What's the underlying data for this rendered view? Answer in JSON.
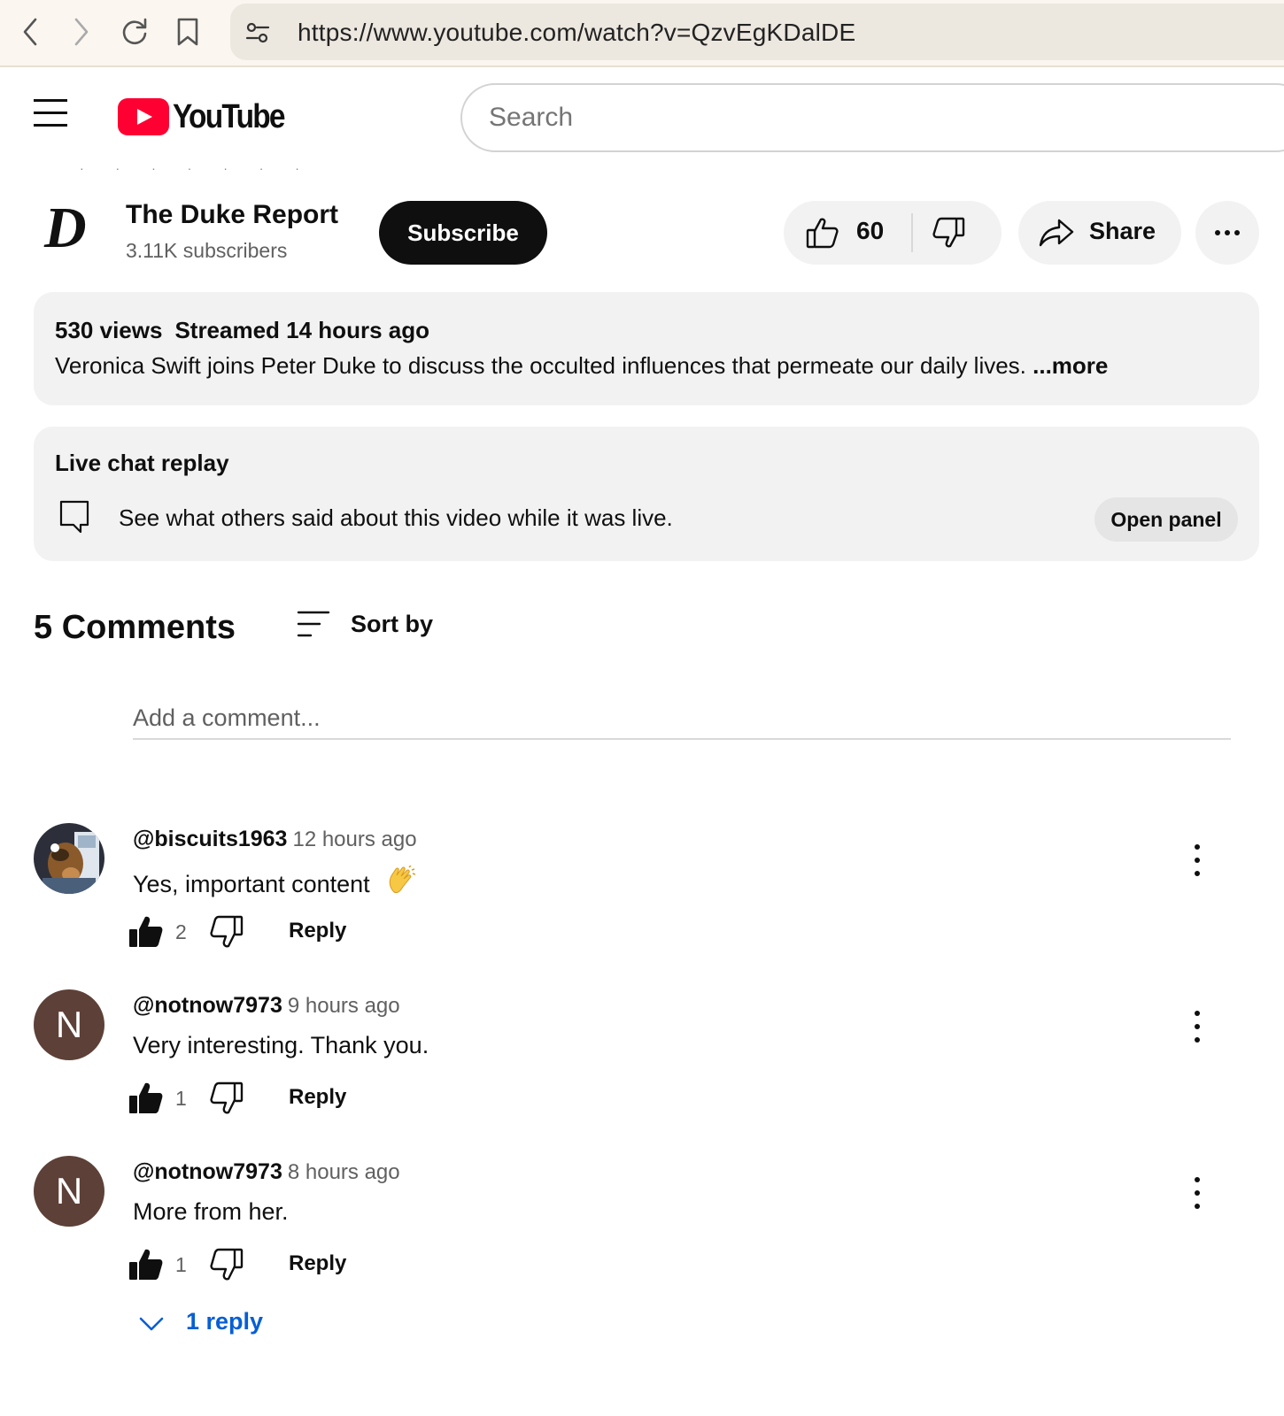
{
  "browser": {
    "url": "https://www.youtube.com/watch?v=QzvEgKDalDE"
  },
  "header": {
    "logo_text": "YouTube",
    "search_placeholder": "Search"
  },
  "channel": {
    "name": "The Duke Report",
    "logo_letter": "D",
    "subscribers": "3.11K subscribers",
    "subscribe_label": "Subscribe"
  },
  "actions": {
    "like_count": "60",
    "share_label": "Share"
  },
  "description": {
    "views": "530 views",
    "streamed": "Streamed 14 hours ago",
    "text": "Veronica Swift joins Peter Duke to discuss the occulted influences that permeate our daily lives.",
    "more_label": "...more"
  },
  "live_chat": {
    "title": "Live chat replay",
    "text": "See what others said about this video while it was live.",
    "button_label": "Open panel"
  },
  "comments": {
    "count_label": "5 Comments",
    "sort_label": "Sort by",
    "add_placeholder": "Add a comment...",
    "items": [
      {
        "author": "@biscuits1963",
        "time": "12 hours ago",
        "text": "Yes, important content",
        "likes": "2",
        "reply_label": "Reply",
        "avatar": "image"
      },
      {
        "author": "@notnow7973",
        "time": "9 hours ago",
        "text": "Very interesting. Thank you.",
        "likes": "1",
        "reply_label": "Reply",
        "avatar_letter": "N"
      },
      {
        "author": "@notnow7973",
        "time": "8 hours ago",
        "text": "More from her.",
        "likes": "1",
        "reply_label": "Reply",
        "avatar_letter": "N"
      }
    ],
    "replies_label": "1 reply"
  },
  "colors": {
    "brand_red": "#ff0033",
    "link_blue": "#065fd4",
    "avatar_brown": "#5d4037"
  }
}
